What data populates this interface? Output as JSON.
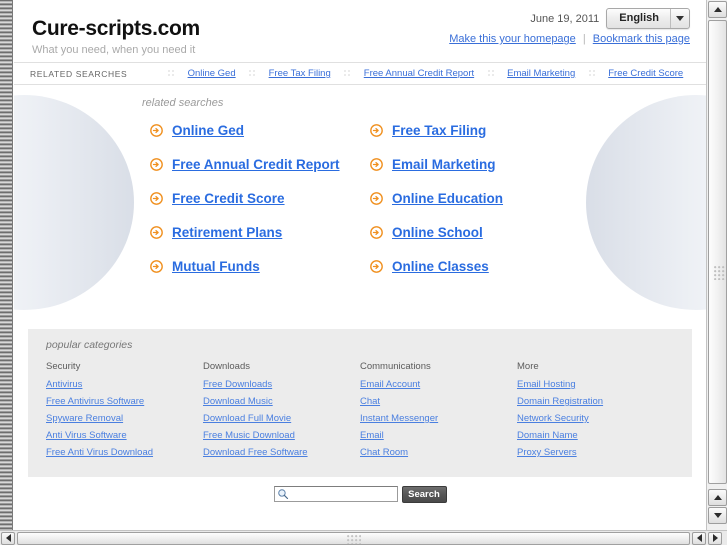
{
  "header": {
    "site_title": "Cure-scripts.com",
    "tagline": "What you need, when you need it",
    "date": "June 19, 2011",
    "language": "English",
    "homepage_link": "Make this your homepage",
    "separator": "|",
    "bookmark_link": "Bookmark this page"
  },
  "related_bar": {
    "title": "RELATED SEARCHES",
    "links": [
      "Online Ged",
      "Free Tax Filing",
      "Free Annual Credit Report",
      "Email Marketing",
      "Free Credit Score"
    ]
  },
  "related_main": {
    "heading": "related searches",
    "left_column": [
      "Online Ged",
      "Free Annual Credit Report",
      "Free Credit Score",
      "Retirement Plans",
      "Mutual Funds"
    ],
    "right_column": [
      "Free Tax Filing",
      "Email Marketing",
      "Online Education",
      "Online School",
      "Online Classes"
    ]
  },
  "categories": {
    "heading": "popular categories",
    "columns": [
      {
        "title": "Security",
        "links": [
          "Antivirus",
          "Free Antivirus Software",
          "Spyware Removal",
          "Anti Virus Software",
          "Free Anti Virus Download"
        ]
      },
      {
        "title": "Downloads",
        "links": [
          "Free Downloads",
          "Download Music",
          "Download Full Movie",
          "Free Music Download",
          "Download Free Software"
        ]
      },
      {
        "title": "Communications",
        "links": [
          "Email Account",
          "Chat",
          "Instant Messenger",
          "Email",
          "Chat Room"
        ]
      },
      {
        "title": "More",
        "links": [
          "Email Hosting",
          "Domain Registration",
          "Network Security",
          "Domain Name",
          "Proxy Servers"
        ]
      }
    ]
  },
  "search": {
    "value": "",
    "placeholder": "",
    "button_label": "Search",
    "icon": "magnifier-icon"
  },
  "colors": {
    "link_blue": "#3a6fd8",
    "main_link_blue": "#2a6ce0",
    "arrow_orange": "#f08a1c",
    "category_bg": "#ececec",
    "search_button_bg": "#575757"
  },
  "icons": {
    "lang_caret": "chevron-down-icon",
    "bullet": "arrow-circle-right-icon",
    "scroll_up": "triangle-up-icon",
    "scroll_down": "triangle-down-icon",
    "scroll_left": "triangle-left-icon",
    "scroll_right": "triangle-right-icon"
  }
}
